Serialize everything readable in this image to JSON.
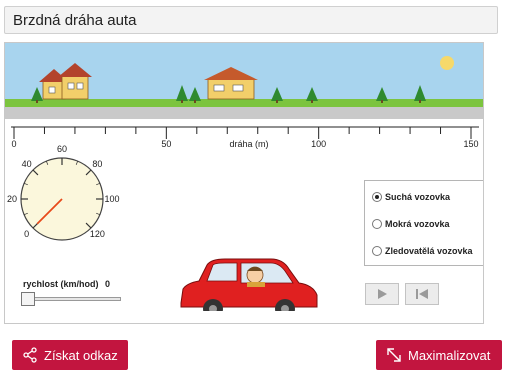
{
  "page": {
    "title": "Brzdná dráha auta"
  },
  "ruler": {
    "axis_label": "dráha (m)",
    "tick_labels": [
      {
        "value": 0,
        "label": "0"
      },
      {
        "value": 50,
        "label": "50"
      },
      {
        "value": 100,
        "label": "100"
      },
      {
        "value": 150,
        "label": "150"
      }
    ],
    "max": 150
  },
  "speedometer": {
    "labels": [
      "0",
      "20",
      "40",
      "60",
      "80",
      "100",
      "120"
    ],
    "max": 120,
    "current_speed": 0
  },
  "speed_control": {
    "caption": "rychlost (km/hod)",
    "value": "0"
  },
  "surface": {
    "options": [
      {
        "label": "Suchá vozovka",
        "selected": true
      },
      {
        "label": "Mokrá vozovka",
        "selected": false
      },
      {
        "label": "Zledovatělá vozovka",
        "selected": false
      }
    ]
  },
  "controls": {
    "play_icon": "play-icon",
    "reset_icon": "reset-icon"
  },
  "footer": {
    "share_label": "Získat odkaz",
    "maximize_label": "Maximalizovat"
  },
  "colors": {
    "accent": "#c2153f",
    "sky": "#a8d4ee",
    "grass": "#7cc43e",
    "car": "#e02020",
    "needle": "#e84a1a"
  }
}
